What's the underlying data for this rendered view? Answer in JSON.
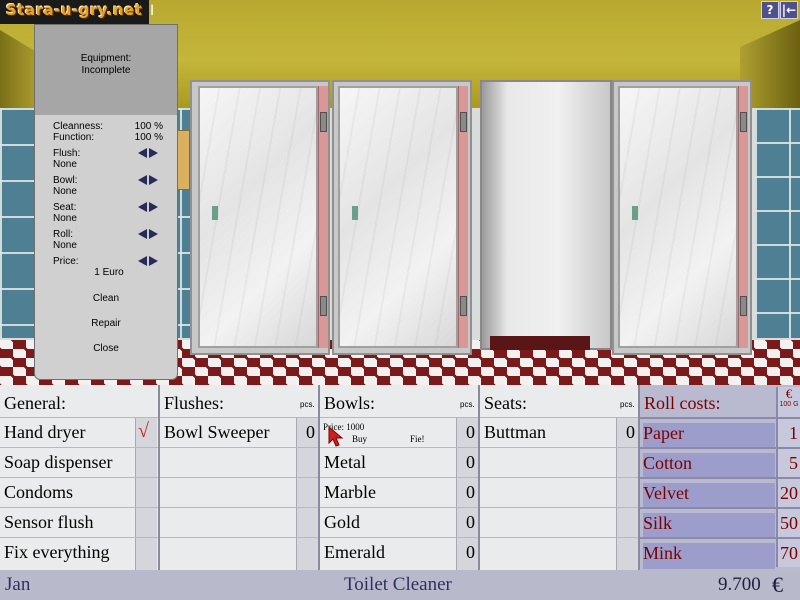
{
  "logo": {
    "text": "Stara-u-gry.net",
    "tail": "I"
  },
  "corner_buttons": {
    "help": "?",
    "exit": "|←"
  },
  "info_panel": {
    "equipment_label": "Equipment:",
    "equipment_value": "Incomplete",
    "cleanness_label": "Cleanness:",
    "cleanness_value": "100 %",
    "function_label": "Function:",
    "function_value": "100 %",
    "flush_label": "Flush:",
    "flush_value": "None",
    "bowl_label": "Bowl:",
    "bowl_value": "None",
    "seat_label": "Seat:",
    "seat_value": "None",
    "roll_label": "Roll:",
    "roll_value": "None",
    "price_label": "Price:",
    "price_value": "1 Euro",
    "clean": "Clean",
    "repair": "Repair",
    "close": "Close"
  },
  "shop": {
    "general": {
      "header": "General:",
      "items": [
        "Hand dryer",
        "Soap dispenser",
        "Condoms",
        "Sensor flush",
        "Fix everything"
      ],
      "checkmark": "√"
    },
    "flushes": {
      "header": "Flushes:",
      "pcs": "pcs.",
      "items": [
        {
          "label": "Bowl Sweeper",
          "count": "0"
        }
      ]
    },
    "bowls": {
      "header": "Bowls:",
      "pcs": "pcs.",
      "tooltip": {
        "price": "Price: 1000",
        "buy": "Buy",
        "fie": "Fie!"
      },
      "items": [
        {
          "label": "",
          "count": "0"
        },
        {
          "label": "Metal",
          "count": "0"
        },
        {
          "label": "Marble",
          "count": "0"
        },
        {
          "label": "Gold",
          "count": "0"
        },
        {
          "label": "Emerald",
          "count": "0"
        }
      ]
    },
    "seats": {
      "header": "Seats:",
      "pcs": "pcs.",
      "items": [
        {
          "label": "Buttman",
          "count": "0"
        }
      ]
    },
    "rolls": {
      "header": "Roll costs:",
      "currency_symbol": "€",
      "currency_amount": "100 G",
      "items": [
        {
          "label": "Paper",
          "count": "1"
        },
        {
          "label": "Cotton",
          "count": "5"
        },
        {
          "label": "Velvet",
          "count": "20"
        },
        {
          "label": "Silk",
          "count": "50"
        },
        {
          "label": "Mink",
          "count": "70"
        }
      ]
    }
  },
  "status_bar": {
    "month": "Jan",
    "rank": "Toilet Cleaner",
    "money": "9.700",
    "currency": "€"
  },
  "colors": {
    "roll_text": "#7a0000",
    "status_text": "#303060",
    "checkmark": "#cc2020",
    "cursor": "#cc2020"
  }
}
